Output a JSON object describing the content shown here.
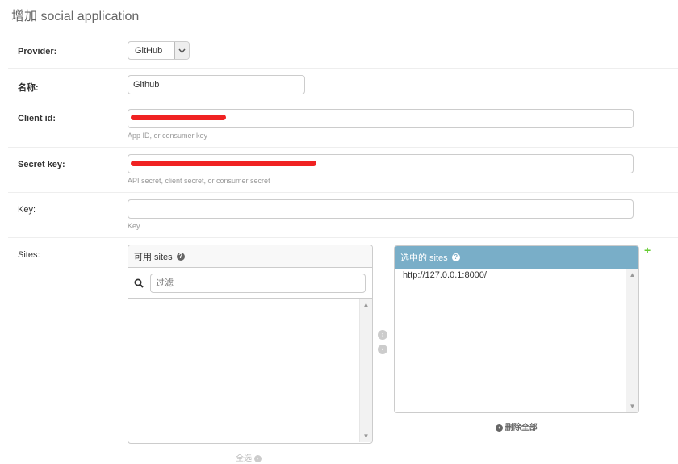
{
  "page": {
    "title": "增加 social application"
  },
  "form": {
    "provider": {
      "label": "Provider:",
      "value": "GitHub"
    },
    "name": {
      "label": "名称:",
      "value": "Github"
    },
    "client_id": {
      "label": "Client id:",
      "help": "App ID, or consumer key"
    },
    "secret_key": {
      "label": "Secret key:",
      "help": "API secret, client secret, or consumer secret"
    },
    "key": {
      "label": "Key:",
      "help": "Key"
    },
    "sites": {
      "label": "Sites:",
      "available_title": "可用 sites",
      "filter_placeholder": "过滤",
      "chosen_title": "选中的 sites",
      "chosen_items": [
        "http://127.0.0.1:8000/"
      ],
      "choose_all": "全选",
      "remove_all": "删除全部"
    }
  },
  "colors": {
    "chosen_header": "#79aec8",
    "add_link": "#66cc33",
    "redaction": "#f02222"
  },
  "icons": {
    "help": "question-circle-icon",
    "search": "search-icon",
    "add": "plus-icon",
    "select": "chevron-down-icon",
    "remove_all": "chevron-left-circle-icon"
  }
}
